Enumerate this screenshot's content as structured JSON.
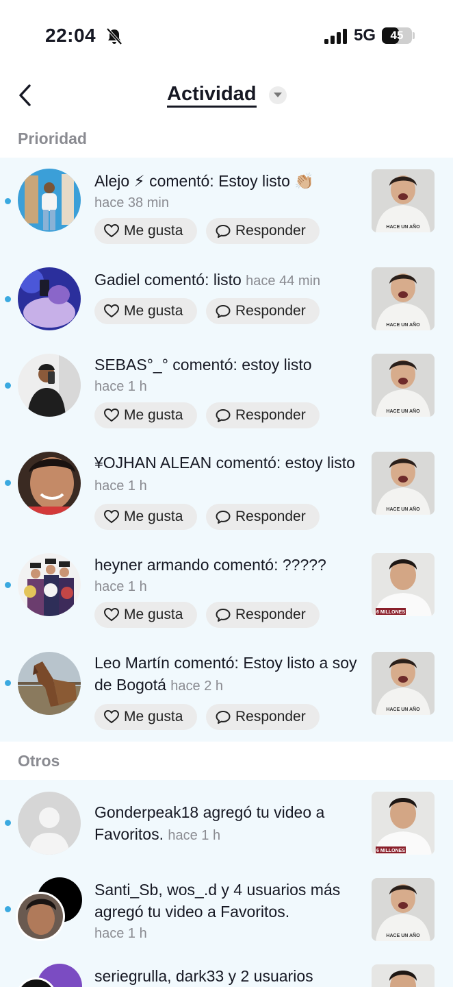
{
  "status_bar": {
    "time": "22:04",
    "network": "5G",
    "battery": "45"
  },
  "header": {
    "title": "Actividad"
  },
  "sections": {
    "priority": "Prioridad",
    "others": "Otros"
  },
  "buttons": {
    "like": "Me gusta",
    "reply": "Responder"
  },
  "priority_items": [
    {
      "line": "Alejo ⚡ comentó: Estoy listo 👏🏼",
      "time": "hace 38 min"
    },
    {
      "line": "Gadiel comentó: listo",
      "time": "hace 44 min"
    },
    {
      "line": "SEBAS°_° comentó: estoy listo",
      "time": "hace 1 h"
    },
    {
      "line": "¥OJHAN ALEAN comentó: estoy listo",
      "time": "hace 1 h"
    },
    {
      "line": "heyner armando comentó: ?????",
      "time": "hace 1 h"
    },
    {
      "line": "Leo Martín comentó: Estoy listo a soy de Bogotá",
      "time": "hace 2 h"
    }
  ],
  "other_items": [
    {
      "line": "Gonderpeak18 agregó tu video a Favoritos.",
      "time": "hace 1 h"
    },
    {
      "line": "Santi_Sb, wos_.d y 4 usuarios más agregó tu video a Favoritos.",
      "time": "hace 1 h"
    },
    {
      "line": "seriegrulla, dark33 y 2 usuarios",
      "time": ""
    }
  ],
  "thumb_labels": {
    "a": "HACE UN AÑO",
    "b": "6 MILLONES"
  },
  "colors": {
    "unread_dot": "#3aa9e0",
    "section_bg": "#f1f9fd",
    "muted_text": "#8a8b91",
    "button_bg": "#ebebeb"
  }
}
